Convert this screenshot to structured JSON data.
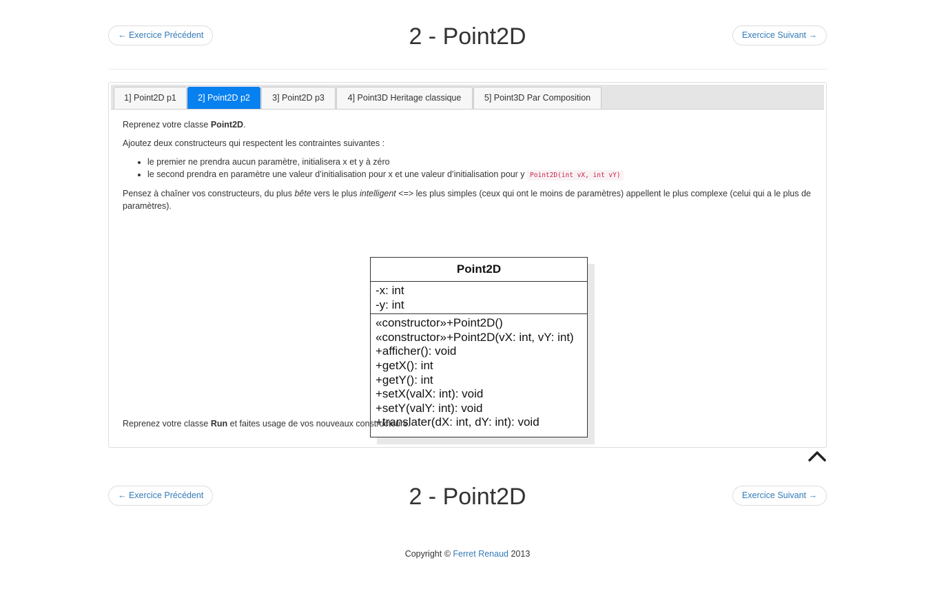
{
  "nav": {
    "prev_label": "← Exercice Précédent",
    "next_label": "Exercice Suivant →",
    "title": "2 - Point2D"
  },
  "tabs": [
    {
      "label": "1] Point2D p1",
      "active": false
    },
    {
      "label": "2] Point2D p2",
      "active": true
    },
    {
      "label": "3] Point2D p3",
      "active": false
    },
    {
      "label": "4] Point3D Heritage classique",
      "active": false
    },
    {
      "label": "5] Point3D Par Composition",
      "active": false
    }
  ],
  "content": {
    "p1_pre": "Reprenez votre classe ",
    "p1_bold": "Point2D",
    "p1_post": ".",
    "p2": "Ajoutez deux constructeurs qui respectent les contraintes suivantes :",
    "bullet1": "le premier ne prendra aucun paramètre, initialisera x et y à zéro",
    "bullet2": "le second prendra en paramètre une valeur d’initialisation pour x et une valeur d’initialisation pour y ",
    "bullet2_code": "Point2D(int vX, int vY)",
    "p3_a": "Pensez à chaîner vos constructeurs, du plus ",
    "p3_em1": "bête",
    "p3_b": " vers le plus ",
    "p3_em2": "intelligent",
    "p3_c": " <=> les plus simples (ceux qui ont le moins de paramètres) appellent le plus complexe (celui qui a le plus de paramètres).",
    "p4_pre": "Reprenez votre classe ",
    "p4_bold": "Run",
    "p4_post": " et faites usage de vos nouveaux constructeurs."
  },
  "uml": {
    "class_name": "Point2D",
    "attributes": [
      "-x: int",
      "-y: int"
    ],
    "methods": [
      "«constructor»+Point2D()",
      "«constructor»+Point2D(vX: int, vY: int)",
      "+afficher(): void",
      "+getX(): int",
      "+getY(): int",
      "+setX(valX: int): void",
      "+setY(valY: int): void",
      "+translater(dX: int, dY: int): void"
    ]
  },
  "footer": {
    "prefix": "Copyright ",
    "symbol": "©",
    "author": "Ferret Renaud",
    "year": " 2013"
  },
  "colors": {
    "accent": "#0780f0",
    "link": "#337ab7",
    "code": "#c7254e"
  },
  "icons": {
    "back_to_top": "chevron-up-icon"
  }
}
